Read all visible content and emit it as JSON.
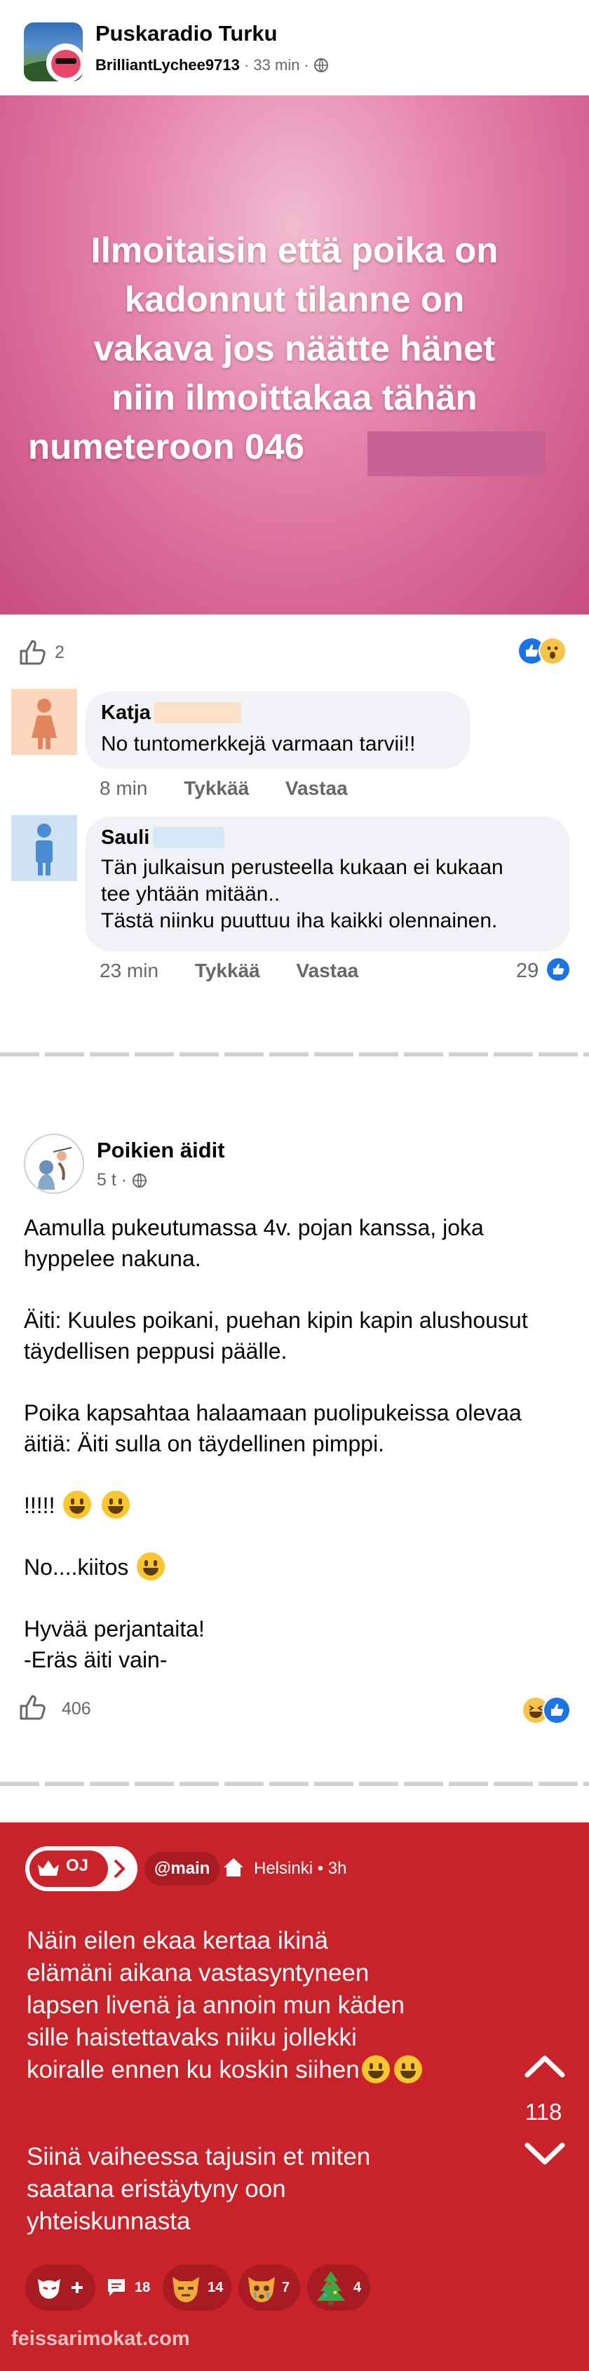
{
  "post1": {
    "group_name": "Puskaradio Turku",
    "author": "BrilliantLychee9713",
    "time": "· 33 min ·",
    "hero_text": "Ilmoitaisin että poika on kadonnut tilanne on vakava  jos näätte hänet niin ilmoittakaa tähän numeteroon 046",
    "hero_text_lines": [
      "Ilmoitaisin että poika on",
      "kadonnut tilanne on",
      "vakava  jos näätte hänet",
      "niin ilmoittakaa tähän",
      "numeteroon 046"
    ],
    "like_count": "2",
    "comments": [
      {
        "name": "Katja",
        "text": "No tuntomerkkejä varmaan tarvii!!",
        "time": "8 min",
        "like_action": "Tykkää",
        "reply_action": "Vastaa"
      },
      {
        "name": "Sauli",
        "text_lines": [
          "Tän julkaisun perusteella kukaan ei kukaan",
          "tee yhtään mitään..",
          "Tästä niinku puuttuu iha kaikki olennainen."
        ],
        "time": "23 min",
        "like_action": "Tykkää",
        "reply_action": "Vastaa",
        "likes": "29"
      }
    ]
  },
  "post2": {
    "page_name": "Poikien äidit",
    "time": "5 t ·",
    "paragraphs": [
      "Aamulla pukeutumassa 4v. pojan kanssa, joka hyppelee nakuna.",
      "Äiti: Kuules poikani, puehan kipin kapin alushousut täydellisen peppusi päälle.",
      "Poika kapsahtaa halaamaan puolipukeissa olevaa äitiä: Äiti sulla on täydellinen pimppi."
    ],
    "exclaim": "!!!!!",
    "thanks": "No....kiitos",
    "sign_lines": [
      "Hyvää perjantaita!",
      "-Eräs äiti vain-"
    ],
    "like_count": "406"
  },
  "post3": {
    "badge": "OJ",
    "username": "@main",
    "location": "Helsinki • 3h",
    "para1_lines": [
      "Näin eilen ekaa kertaa ikinä",
      "elämäni aikana vastasyntyneen",
      "lapsen livenä ja annoin mun käden",
      "sille haistettavaks niiku jollekki",
      "koiralle ennen ku koskin siihen"
    ],
    "para2_lines": [
      "Siinä vaiheessa tajusin et miten",
      "saatana eristäytyny oon",
      "yhteiskunnasta"
    ],
    "votes": "118",
    "comments_count": "18",
    "reaction_counts": [
      "14",
      "7",
      "4"
    ]
  },
  "watermark": "feissarimokat.com",
  "colors": {
    "facebook_blue": "#1b74e4",
    "hero_pink": "#d96b98",
    "card_red": "#c8222a",
    "bubble_gray": "#f0f2f5",
    "katja_redact": "#fde0c8",
    "sauli_redact": "#d4e8f8"
  },
  "icons": [
    "thumbs-up-icon",
    "globe-icon",
    "like-reaction-icon",
    "wow-reaction-icon",
    "haha-reaction-icon",
    "female-avatar-icon",
    "male-avatar-icon",
    "crown-icon",
    "home-icon",
    "arrow-up-icon",
    "arrow-down-icon",
    "comment-icon",
    "add-reaction-icon"
  ]
}
